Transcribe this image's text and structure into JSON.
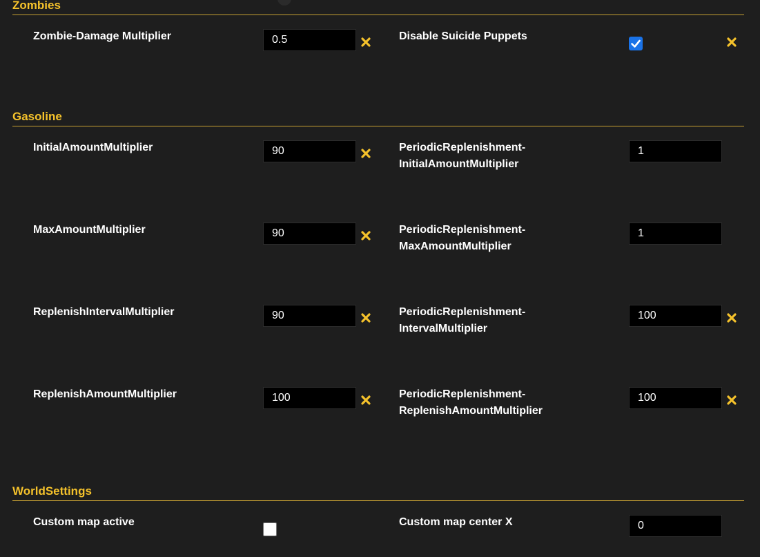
{
  "colors": {
    "background": "#1e1e1e",
    "section_title": "#f5c22b",
    "reset_icon": "#f5c22b",
    "checkbox_checked": "#1a73e8"
  },
  "sections": {
    "zombies": {
      "title": "Zombies",
      "zombie_damage": {
        "label": "Zombie-Damage Multiplier",
        "value": "0.5",
        "reset_icon": "close-icon"
      },
      "disable_suicide_puppets": {
        "label": "Disable Suicide Puppets",
        "checked": true,
        "reset_icon": "close-icon"
      }
    },
    "gasoline": {
      "title": "Gasoline",
      "initial_amount": {
        "label": "InitialAmountMultiplier",
        "value": "90"
      },
      "periodic_initial_amount": {
        "label_line1": "PeriodicReplenishment-",
        "label_line2": "InitialAmountMultiplier",
        "value": "1"
      },
      "max_amount": {
        "label": "MaxAmountMultiplier",
        "value": "90"
      },
      "periodic_max_amount": {
        "label_line1": "PeriodicReplenishment-",
        "label_line2": "MaxAmountMultiplier",
        "value": "1"
      },
      "replenish_interval": {
        "label": "ReplenishIntervalMultiplier",
        "value": "90"
      },
      "periodic_interval": {
        "label_line1": "PeriodicReplenishment-",
        "label_line2": "IntervalMultiplier",
        "value": "100"
      },
      "replenish_amount": {
        "label": "ReplenishAmountMultiplier",
        "value": "100"
      },
      "periodic_replenish_amount": {
        "label_line1": "PeriodicReplenishment-",
        "label_line2": "ReplenishAmountMultiplier",
        "value": "100"
      }
    },
    "world_settings": {
      "title": "WorldSettings",
      "custom_map_active": {
        "label": "Custom map active",
        "checked": false
      },
      "custom_map_center_x": {
        "label": "Custom map center X",
        "value": "0"
      }
    }
  }
}
